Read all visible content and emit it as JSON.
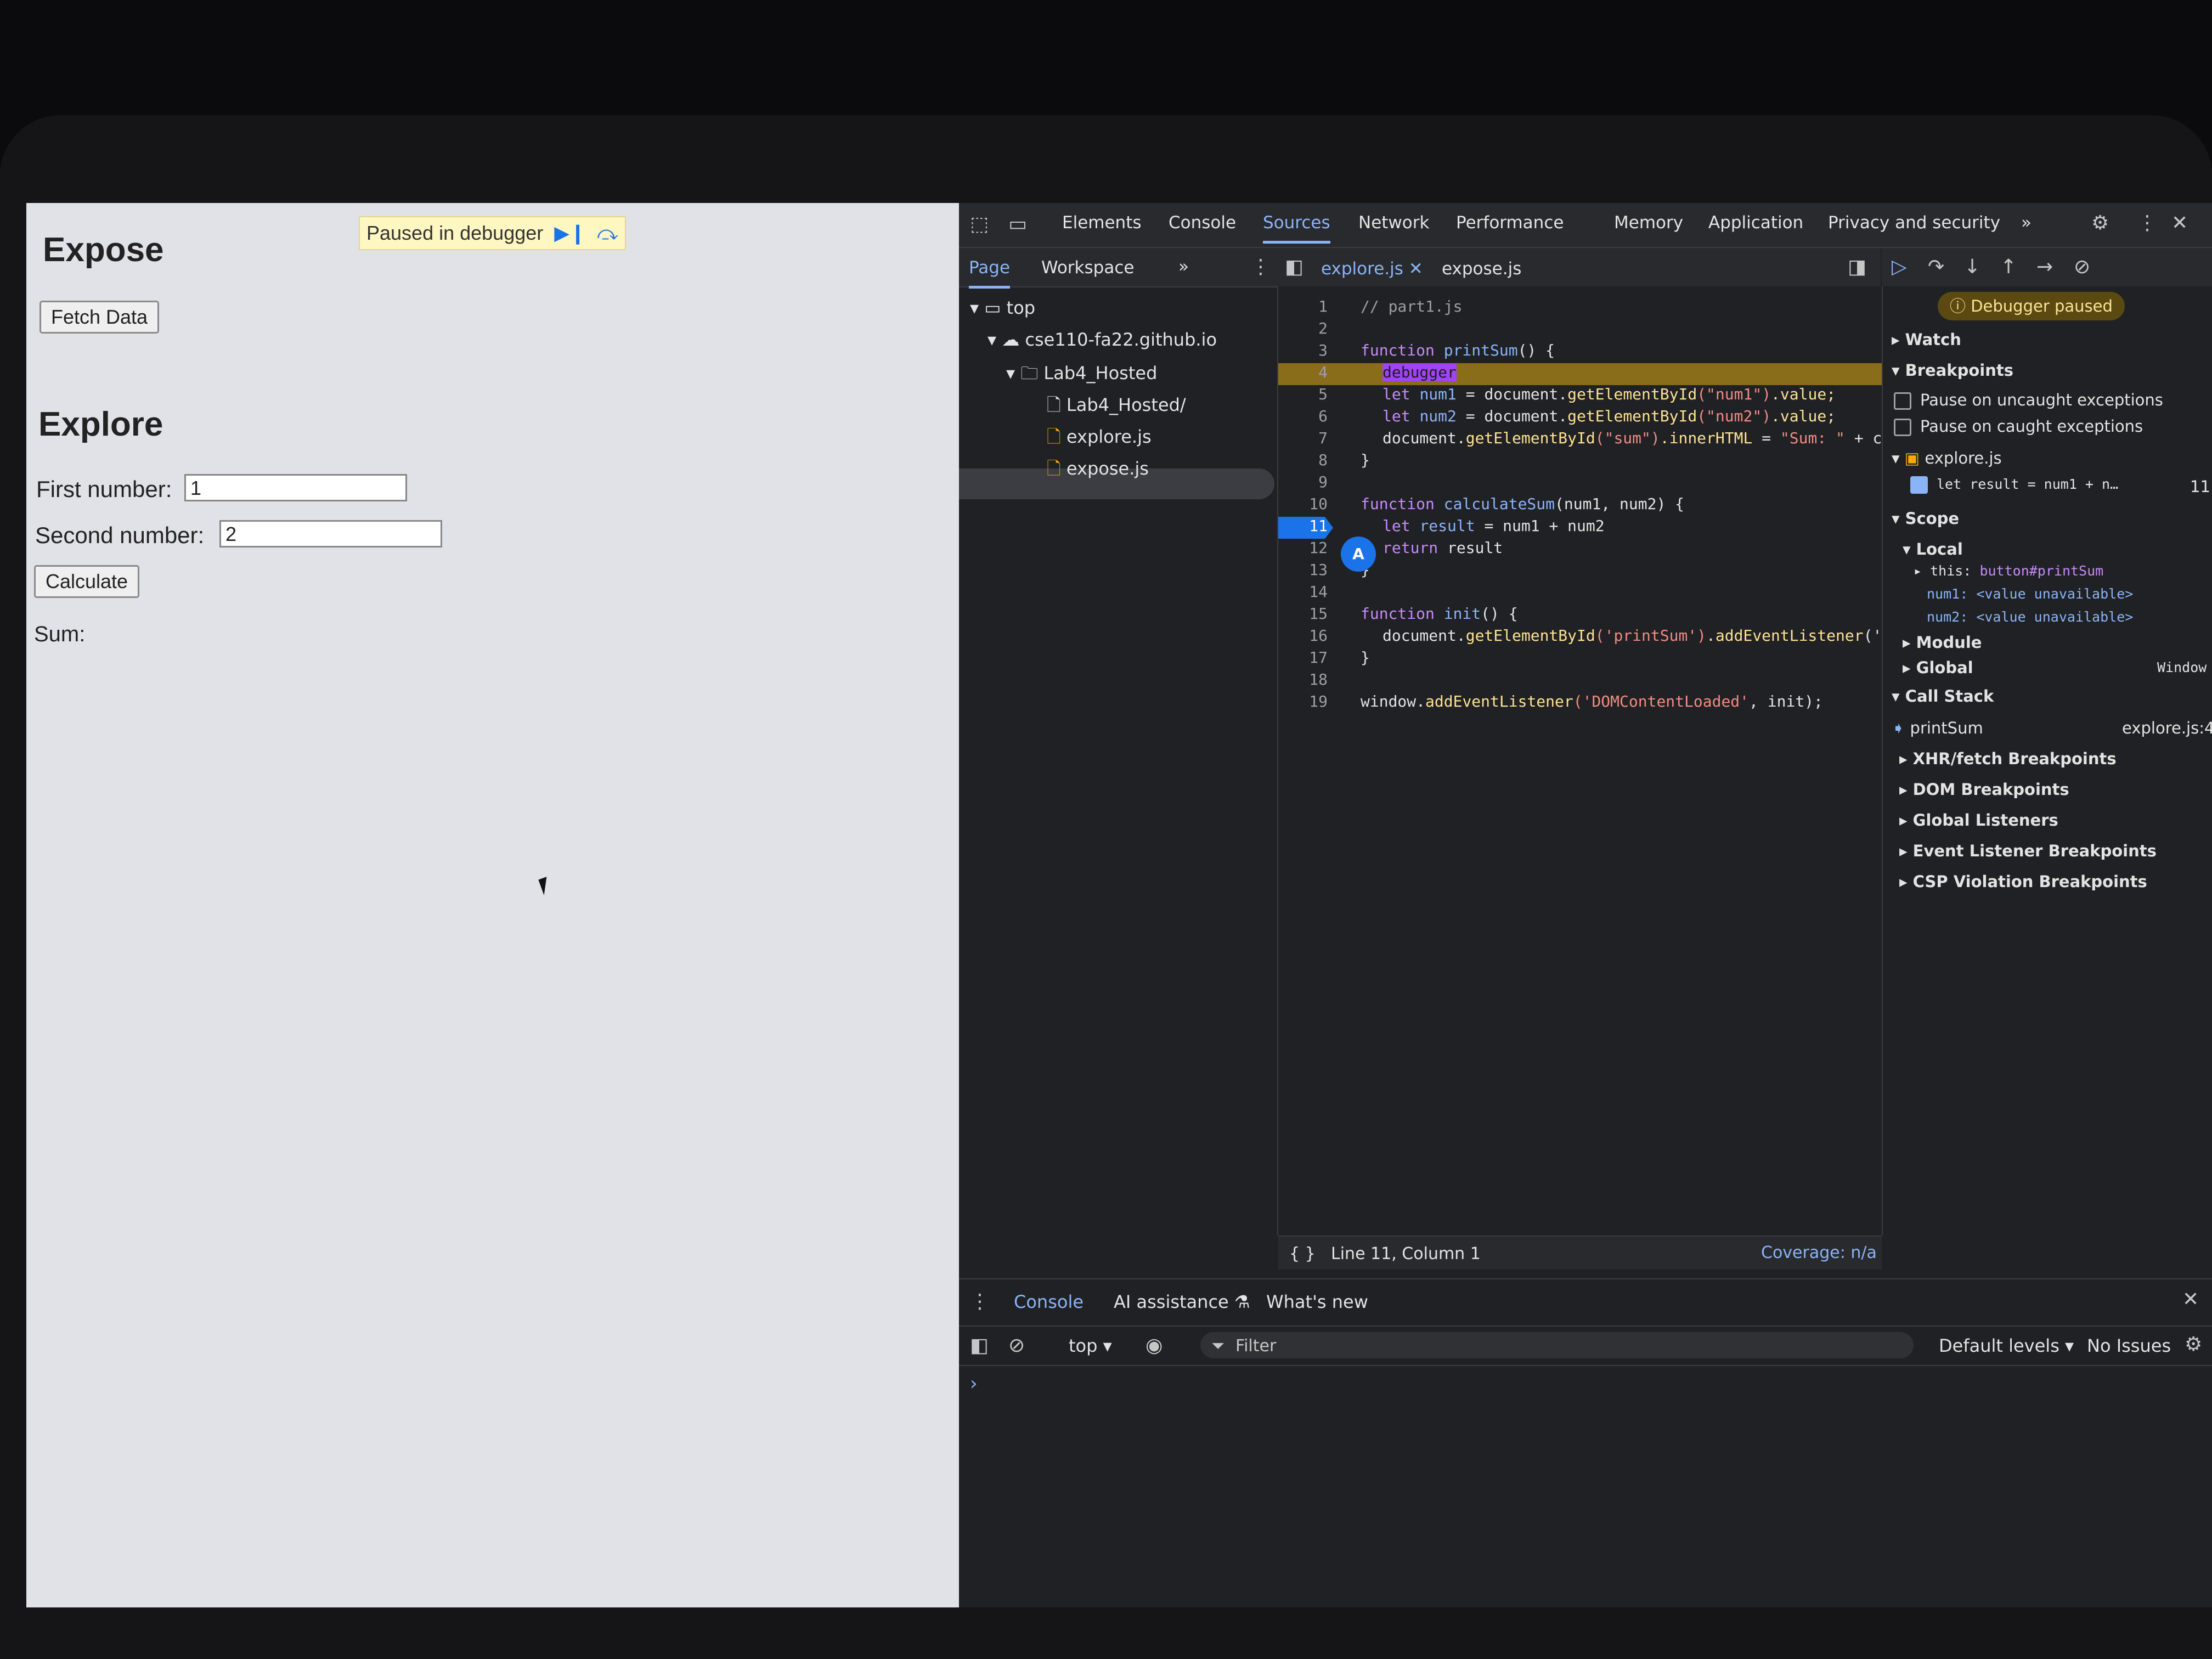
{
  "webpage": {
    "expose_heading": "Expose",
    "fetch_button": "Fetch Data",
    "explore_heading": "Explore",
    "first_label": "First number:",
    "first_value": "1",
    "second_label": "Second number:",
    "second_value": "2",
    "calculate_button": "Calculate",
    "sum_label": "Sum:",
    "paused_banner": "Paused in debugger"
  },
  "devtools": {
    "tabs": [
      "Elements",
      "Console",
      "Sources",
      "Network",
      "Performance",
      "Memory",
      "Application",
      "Privacy and security"
    ],
    "active_tab": "Sources",
    "more": "»",
    "navigator": {
      "tabs": [
        "Page",
        "Workspace"
      ],
      "tree": {
        "top": "top",
        "domain": "cse110-fa22.github.io",
        "folder": "Lab4_Hosted",
        "items": [
          "Lab4_Hosted/",
          "explore.js",
          "expose.js"
        ]
      }
    },
    "editor": {
      "open_files": [
        "explore.js",
        "expose.js"
      ],
      "lines": [
        {
          "n": "1"
        },
        {
          "n": "2"
        },
        {
          "n": "3"
        },
        {
          "n": "4"
        },
        {
          "n": "5"
        },
        {
          "n": "6"
        },
        {
          "n": "7"
        },
        {
          "n": "8"
        },
        {
          "n": "9"
        },
        {
          "n": "10"
        },
        {
          "n": "11"
        },
        {
          "n": "12"
        },
        {
          "n": "13"
        },
        {
          "n": "14"
        },
        {
          "n": "15"
        },
        {
          "n": "16"
        },
        {
          "n": "17"
        },
        {
          "n": "18"
        },
        {
          "n": "19"
        }
      ],
      "code": {
        "l1": "// part1.js",
        "l3_kw": "function",
        "l3_fn": "printSum",
        "l3_rest": "() {",
        "l4": "debugger",
        "l5_a": "let",
        "l5_b": "num1",
        "l5_c": " = document.",
        "l5_d": "getElementById",
        "l5_e": "(\"num1\")",
        "l5_f": ".value;",
        "l6_a": "let",
        "l6_b": "num2",
        "l6_c": " = document.",
        "l6_d": "getElementById",
        "l6_e": "(\"num2\")",
        "l6_f": ".value;",
        "l7_a": "document.",
        "l7_b": "getElementById",
        "l7_c": "(\"sum\")",
        "l7_d": ".innerHTML",
        "l7_e": " = ",
        "l7_f": "\"Sum: \"",
        "l7_g": " + ca",
        "l8": "}",
        "l10_kw": "function",
        "l10_fn": "calculateSum",
        "l10_rest": "(num1, num2) {",
        "l11_a": "let",
        "l11_b": "result",
        "l11_c": " = num1 + num2",
        "l12_a": "return",
        "l12_b": " result",
        "l13": "}",
        "l15_kw": "function",
        "l15_fn": "init",
        "l15_rest": "() {",
        "l16_a": "document.",
        "l16_b": "getElementById",
        "l16_c": "('printSum')",
        "l16_d": ".addEventListener",
        "l16_e": "('c",
        "l17": "}",
        "l19_a": "window.",
        "l19_b": "addEventListener",
        "l19_c": "('DOMContentLoaded'",
        "l19_d": ", init);"
      },
      "breakpoint_badge": "A",
      "status_position": "Line 11, Column 1",
      "coverage": "Coverage: n/a"
    },
    "debugger": {
      "paused_badge": "Debugger paused",
      "watch": "Watch",
      "breakpoints": "Breakpoints",
      "pause_uncaught": "Pause on uncaught exceptions",
      "pause_caught": "Pause on caught exceptions",
      "bp_file": "explore.js",
      "bp_code": "let result = num1 + n…",
      "bp_line": "11",
      "scope": "Scope",
      "local": "Local",
      "this_key": "this:",
      "this_val": "button#printSum",
      "num1_key": "num1:",
      "num1_val": "<value unavailable>",
      "num2_key": "num2:",
      "num2_val": "<value unavailable>",
      "module": "Module",
      "global": "Global",
      "global_val": "Window",
      "call_stack": "Call Stack",
      "frame_name": "printSum",
      "frame_loc": "explore.js:4",
      "sections": [
        "XHR/fetch Breakpoints",
        "DOM Breakpoints",
        "Global Listeners",
        "Event Listener Breakpoints",
        "CSP Violation Breakpoints"
      ]
    },
    "drawer": {
      "tabs": [
        "Console",
        "AI assistance",
        "What's new"
      ],
      "context": "top",
      "filter": "Filter",
      "levels": "Default levels",
      "issues": "No Issues",
      "prompt": "›"
    }
  }
}
